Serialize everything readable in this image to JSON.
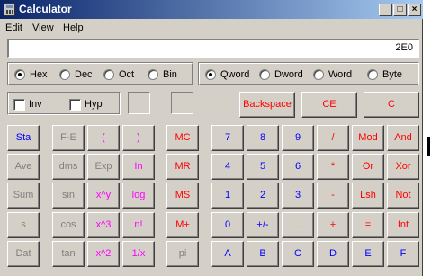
{
  "window": {
    "title": "Calculator"
  },
  "titlebar": {
    "minimize_glyph": "_",
    "maximize_glyph": "□",
    "close_glyph": "×"
  },
  "menu": [
    "Edit",
    "View",
    "Help"
  ],
  "display": {
    "value": "2E0"
  },
  "radix_options": [
    {
      "label": "Hex",
      "checked": true
    },
    {
      "label": "Dec",
      "checked": false
    },
    {
      "label": "Oct",
      "checked": false
    },
    {
      "label": "Bin",
      "checked": false
    }
  ],
  "word_options": [
    {
      "label": "Qword",
      "checked": true
    },
    {
      "label": "Dword",
      "checked": false
    },
    {
      "label": "Word",
      "checked": false
    },
    {
      "label": "Byte",
      "checked": false
    }
  ],
  "checkboxes": [
    {
      "label": "Inv",
      "checked": false
    },
    {
      "label": "Hyp",
      "checked": false
    }
  ],
  "edit_buttons": [
    "Backspace",
    "CE",
    "C"
  ],
  "colors": {
    "face": "#d4d0c8",
    "blue_label": "#0000ff",
    "red_label": "#ff0000",
    "magenta_label": "#ff00ff",
    "gray_label": "#808080",
    "title_start": "#0a246a",
    "title_end": "#a6caf0"
  },
  "button_rows": [
    [
      {
        "label": "Sta",
        "color": "blue"
      },
      {
        "label": "F-E",
        "color": "gray"
      },
      {
        "label": "(",
        "color": "magenta"
      },
      {
        "label": ")",
        "color": "magenta"
      },
      {
        "label": "MC",
        "color": "red"
      },
      {
        "label": "7",
        "color": "blue"
      },
      {
        "label": "8",
        "color": "blue"
      },
      {
        "label": "9",
        "color": "blue"
      },
      {
        "label": "/",
        "color": "red"
      },
      {
        "label": "Mod",
        "color": "red"
      },
      {
        "label": "And",
        "color": "red"
      }
    ],
    [
      {
        "label": "Ave",
        "color": "gray"
      },
      {
        "label": "dms",
        "color": "gray"
      },
      {
        "label": "Exp",
        "color": "gray"
      },
      {
        "label": "In",
        "color": "magenta"
      },
      {
        "label": "MR",
        "color": "red"
      },
      {
        "label": "4",
        "color": "blue"
      },
      {
        "label": "5",
        "color": "blue"
      },
      {
        "label": "6",
        "color": "blue"
      },
      {
        "label": "*",
        "color": "red"
      },
      {
        "label": "Or",
        "color": "red"
      },
      {
        "label": "Xor",
        "color": "red"
      }
    ],
    [
      {
        "label": "Sum",
        "color": "gray"
      },
      {
        "label": "sin",
        "color": "gray"
      },
      {
        "label": "x^y",
        "color": "magenta"
      },
      {
        "label": "log",
        "color": "magenta"
      },
      {
        "label": "MS",
        "color": "red"
      },
      {
        "label": "1",
        "color": "blue"
      },
      {
        "label": "2",
        "color": "blue"
      },
      {
        "label": "3",
        "color": "blue"
      },
      {
        "label": "-",
        "color": "red"
      },
      {
        "label": "Lsh",
        "color": "red"
      },
      {
        "label": "Not",
        "color": "red"
      }
    ],
    [
      {
        "label": "s",
        "color": "gray"
      },
      {
        "label": "cos",
        "color": "gray"
      },
      {
        "label": "x^3",
        "color": "magenta"
      },
      {
        "label": "n!",
        "color": "magenta"
      },
      {
        "label": "M+",
        "color": "red"
      },
      {
        "label": "0",
        "color": "blue"
      },
      {
        "label": "+/-",
        "color": "blue"
      },
      {
        "label": ".",
        "color": "gray"
      },
      {
        "label": "+",
        "color": "red"
      },
      {
        "label": "=",
        "color": "red"
      },
      {
        "label": "Int",
        "color": "red"
      }
    ],
    [
      {
        "label": "Dat",
        "color": "gray"
      },
      {
        "label": "tan",
        "color": "gray"
      },
      {
        "label": "x^2",
        "color": "magenta"
      },
      {
        "label": "1/x",
        "color": "magenta"
      },
      {
        "label": "pi",
        "color": "gray"
      },
      {
        "label": "A",
        "color": "blue"
      },
      {
        "label": "B",
        "color": "blue"
      },
      {
        "label": "C",
        "color": "blue"
      },
      {
        "label": "D",
        "color": "blue"
      },
      {
        "label": "E",
        "color": "blue"
      },
      {
        "label": "F",
        "color": "blue"
      }
    ]
  ]
}
